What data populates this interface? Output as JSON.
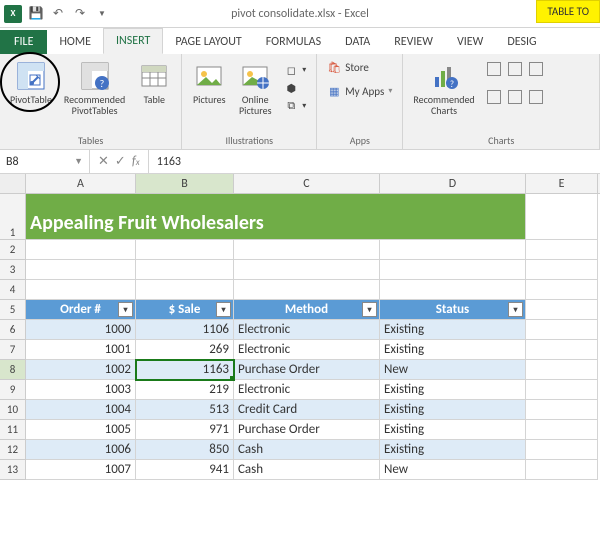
{
  "titlebar": {
    "title": "pivot consolidate.xlsx - Excel",
    "table_tools": "TABLE TO"
  },
  "tabs": {
    "file": "FILE",
    "home": "HOME",
    "insert": "INSERT",
    "page_layout": "PAGE LAYOUT",
    "formulas": "FORMULAS",
    "data": "DATA",
    "review": "REVIEW",
    "view": "VIEW",
    "design": "DESIG"
  },
  "ribbon": {
    "tables": {
      "pivot_table": "PivotTable",
      "recommended": "Recommended\nPivotTables",
      "table": "Table",
      "label": "Tables"
    },
    "illustrations": {
      "pictures": "Pictures",
      "online_pictures": "Online\nPictures",
      "label": "Illustrations"
    },
    "apps": {
      "store": "Store",
      "my_apps": "My Apps",
      "label": "Apps"
    },
    "charts": {
      "recommended": "Recommended\nCharts",
      "label": "Charts"
    }
  },
  "namebox": "B8",
  "formula": "1163",
  "columns": [
    "A",
    "B",
    "C",
    "D",
    "E"
  ],
  "row_numbers": [
    "1",
    "2",
    "3",
    "4",
    "5",
    "6",
    "7",
    "8",
    "9",
    "10",
    "11",
    "12",
    "13"
  ],
  "sheet": {
    "title": "Appealing Fruit Wholesalers",
    "headers": [
      "Order #",
      "$ Sale",
      "Method",
      "Status"
    ],
    "rows": [
      {
        "order": "1000",
        "sale": "1106",
        "method": "Electronic",
        "status": "Existing"
      },
      {
        "order": "1001",
        "sale": "269",
        "method": "Electronic",
        "status": "Existing"
      },
      {
        "order": "1002",
        "sale": "1163",
        "method": "Purchase Order",
        "status": "New"
      },
      {
        "order": "1003",
        "sale": "219",
        "method": "Electronic",
        "status": "Existing"
      },
      {
        "order": "1004",
        "sale": "513",
        "method": "Credit Card",
        "status": "Existing"
      },
      {
        "order": "1005",
        "sale": "971",
        "method": "Purchase Order",
        "status": "Existing"
      },
      {
        "order": "1006",
        "sale": "850",
        "method": "Cash",
        "status": "Existing"
      },
      {
        "order": "1007",
        "sale": "941",
        "method": "Cash",
        "status": "New"
      }
    ]
  },
  "active_cell": "B8",
  "colors": {
    "brand": "#217346",
    "accent": "#5b9bd5",
    "title_bg": "#70ad47"
  }
}
